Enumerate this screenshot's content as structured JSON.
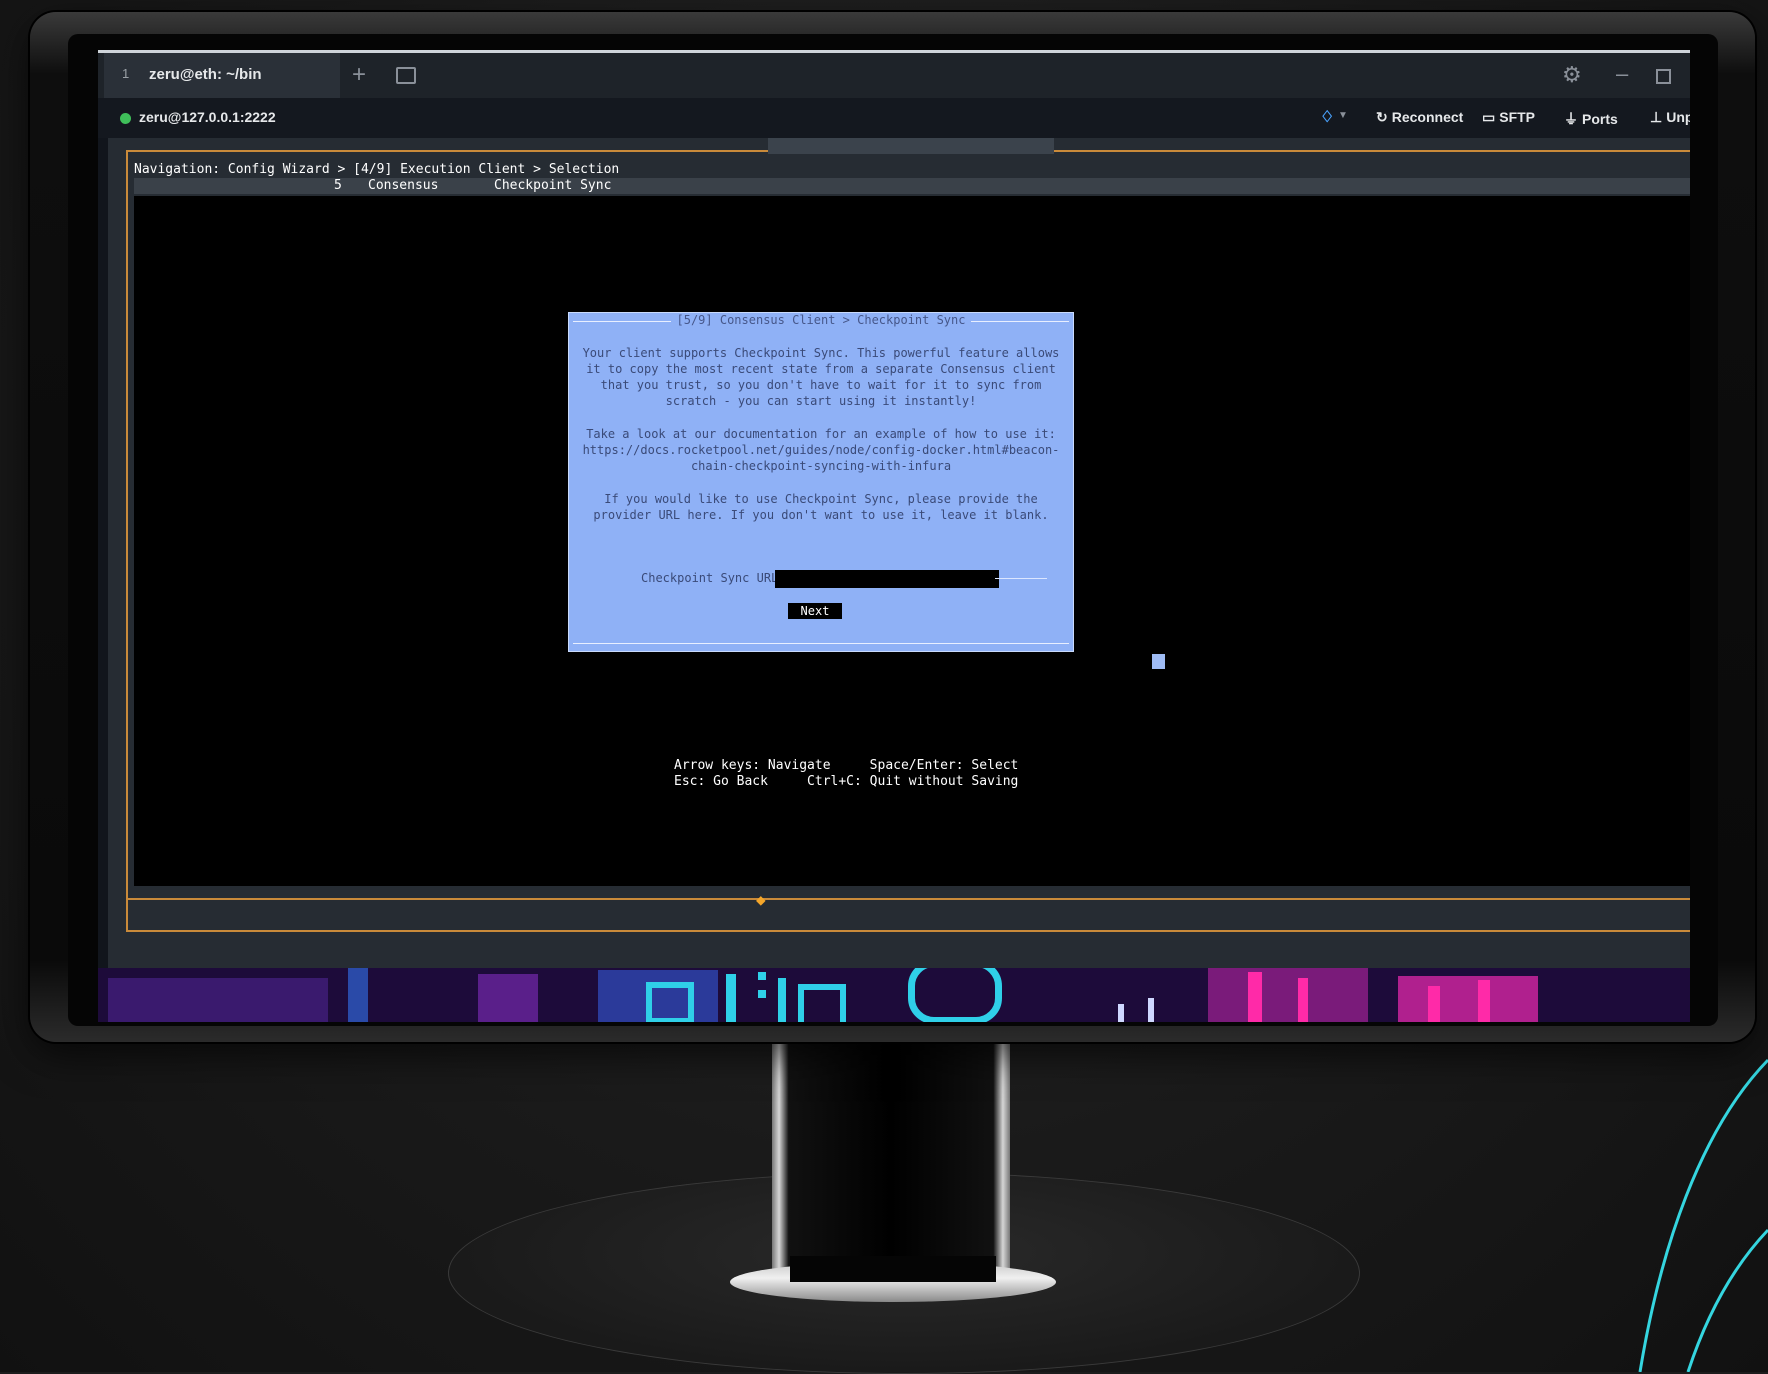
{
  "window": {
    "tab_number": "1",
    "tab_title": "zeru@eth: ~/bin"
  },
  "connection": {
    "host": "zeru@127.0.0.1:2222",
    "reconnect_label": "Reconnect",
    "sftp_label": "SFTP",
    "ports_label": "Ports",
    "unpin_label": "Unp"
  },
  "terminal": {
    "navigation": "Navigation: Config Wizard > [4/9] Execution Client > Selection",
    "subnav_step": "5",
    "subnav_section": "Consensus",
    "subnav_page": "Checkpoint Sync",
    "help_line1": "Arrow keys: Navigate     Space/Enter: Select",
    "help_line2": "Esc: Go Back     Ctrl+C: Quit without Saving"
  },
  "dialog": {
    "title": "[5/9] Consensus Client > Checkpoint Sync",
    "paragraph1": "Your client supports Checkpoint Sync. This powerful feature allows it to copy the most recent state from a separate Consensus client that you trust, so you don't have to wait for it to sync from scratch - you can start using it instantly!",
    "paragraph2": "Take a look at our documentation for an example of how to use it: https://docs.rocketpool.net/guides/node/config-docker.html#beacon-chain-checkpoint-syncing-with-infura",
    "paragraph3": "If you would like to use Checkpoint Sync, please provide the provider URL here. If you don't want to use it, leave it blank.",
    "url_label": "Checkpoint Sync URL",
    "url_value": "",
    "next_label": "Next"
  },
  "colors": {
    "dialog_bg": "#8fb1f6",
    "frame_accent": "#c98a3a",
    "status_online": "#3fbf5a"
  }
}
